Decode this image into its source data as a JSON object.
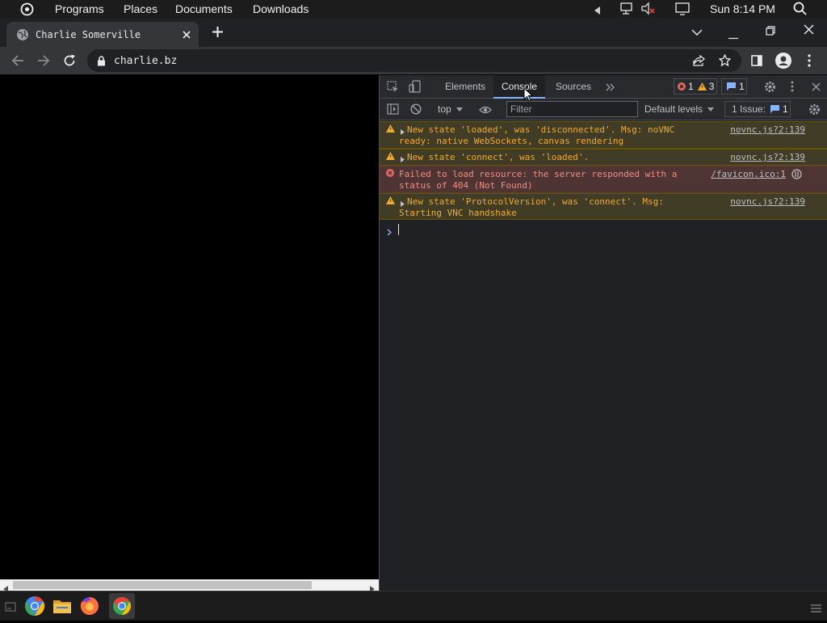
{
  "topbar": {
    "menus": [
      "Programs",
      "Places",
      "Documents",
      "Downloads"
    ],
    "clock": "Sun 8:14 PM"
  },
  "browser": {
    "tab_title": "Charlie Somerville",
    "url": "charlie.bz"
  },
  "devtools": {
    "tabs": [
      "Elements",
      "Console",
      "Sources"
    ],
    "active_tab": "Console",
    "error_count": "1",
    "warning_count": "3",
    "info_count": "1",
    "context": "top",
    "filter_placeholder": "Filter",
    "levels": "Default levels",
    "issues_label": "1 Issue:",
    "issues_count": "1",
    "messages": [
      {
        "level": "warning",
        "text": "New state 'loaded', was 'disconnected'. Msg: noVNC\nready: native WebSockets, canvas rendering",
        "source": "novnc.js?2:139"
      },
      {
        "level": "warning",
        "text": "New state 'connect', was 'loaded'.",
        "source": "novnc.js?2:139"
      },
      {
        "level": "error",
        "text": "Failed to load resource: the server responded with a\nstatus of 404 (Not Found)",
        "source": "/favicon.ico:1"
      },
      {
        "level": "warning",
        "text": "New state 'ProtocolVersion', was 'connect'. Msg:\nStarting VNC handshake",
        "source": "novnc.js?2:139"
      }
    ]
  },
  "taskbar": {
    "apps": [
      "chromium-icon",
      "files-icon",
      "firefox-icon",
      "chrome-icon"
    ]
  },
  "colors": {
    "warning": "#f2ab26",
    "error": "#f28b82",
    "accent": "#8ab4f8"
  }
}
